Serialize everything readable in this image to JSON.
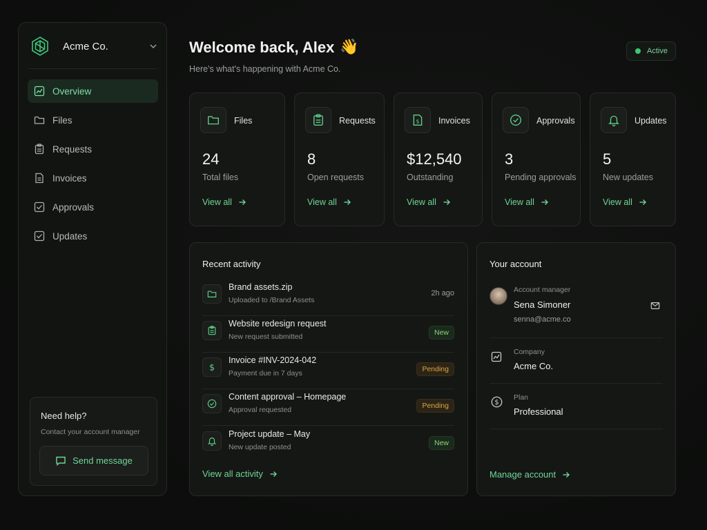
{
  "org": {
    "name": "Acme Co."
  },
  "nav": [
    {
      "label": "Overview",
      "icon": "chart-icon",
      "active": true
    },
    {
      "label": "Files",
      "icon": "folder-icon"
    },
    {
      "label": "Requests",
      "icon": "clipboard-icon"
    },
    {
      "label": "Invoices",
      "icon": "document-icon"
    },
    {
      "label": "Approvals",
      "icon": "check-square-icon"
    },
    {
      "label": "Updates",
      "icon": "check-square-icon"
    }
  ],
  "help": {
    "title": "Need help?",
    "subtitle": "Contact your account manager",
    "button": "Send message"
  },
  "header": {
    "title": "Welcome back, Alex",
    "emoji": "👋",
    "subtitle": "Here's what's happening with Acme Co.",
    "status": "Active"
  },
  "stats": [
    {
      "label": "Files",
      "value": "24",
      "desc": "Total files",
      "link": "View all",
      "icon": "folder-icon"
    },
    {
      "label": "Requests",
      "value": "8",
      "desc": "Open requests",
      "link": "View all",
      "icon": "clipboard-icon"
    },
    {
      "label": "Invoices",
      "value": "$12,540",
      "desc": "Outstanding",
      "link": "View all",
      "icon": "invoice-icon"
    },
    {
      "label": "Approvals",
      "value": "3",
      "desc": "Pending approvals",
      "link": "View all",
      "icon": "check-circle-icon"
    },
    {
      "label": "Updates",
      "value": "5",
      "desc": "New updates",
      "link": "View all",
      "icon": "bell-icon"
    }
  ],
  "activity": {
    "title": "Recent activity",
    "items": [
      {
        "title": "Brand assets.zip",
        "subtitle": "Uploaded to /Brand Assets",
        "meta": "2h ago",
        "icon": "folder-icon"
      },
      {
        "title": "Website redesign request",
        "subtitle": "New request submitted",
        "badge": "New",
        "icon": "clipboard-icon"
      },
      {
        "title": "Invoice #INV-2024-042",
        "subtitle": "Payment due in 7 days",
        "badge": "Pending",
        "icon": "dollar-icon"
      },
      {
        "title": "Content approval – Homepage",
        "subtitle": "Approval requested",
        "badge": "Pending",
        "icon": "check-circle-icon"
      },
      {
        "title": "Project update – May",
        "subtitle": "New update posted",
        "badge": "New",
        "icon": "bell-icon"
      }
    ],
    "link": "View all activity"
  },
  "account": {
    "title": "Your account",
    "manager_label": "Account manager",
    "manager_name": "Sena Simoner",
    "manager_email": "senna@acme.co",
    "company_label": "Company",
    "company": "Acme Co.",
    "plan_label": "Plan",
    "plan": "Professional",
    "link": "Manage account"
  },
  "colors": {
    "accent": "#6fd697",
    "active_dot": "#3ec871",
    "pending": "#d9a64a",
    "new": "#8ed47a"
  }
}
